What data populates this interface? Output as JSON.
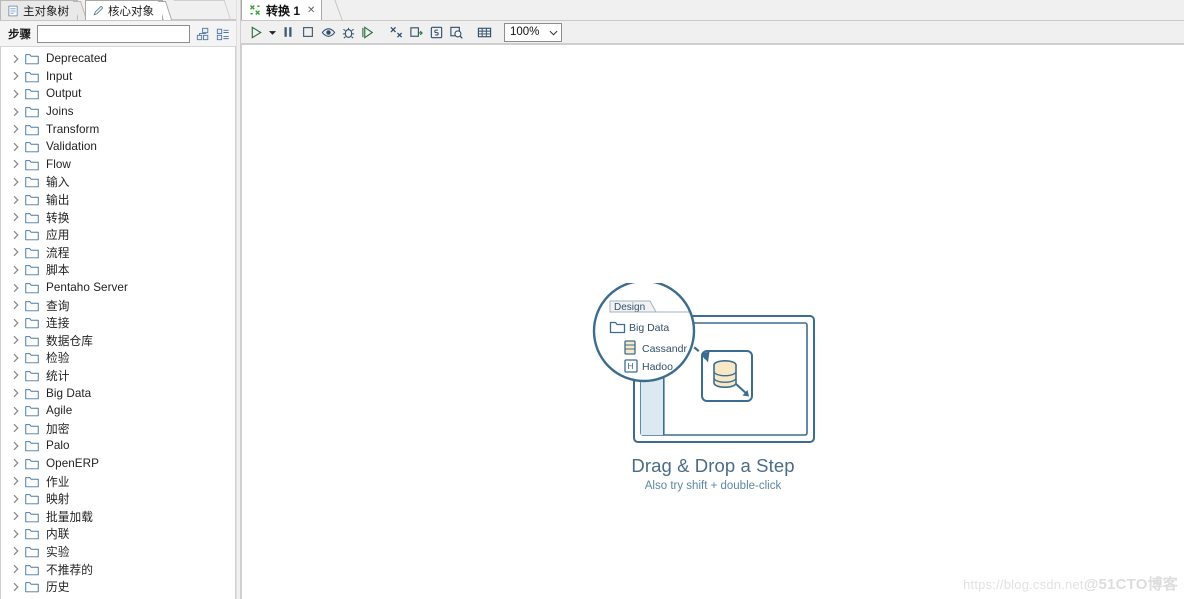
{
  "left_panel": {
    "tabs": [
      {
        "label": "主对象树",
        "icon": "document-icon",
        "active": false
      },
      {
        "label": "核心对象",
        "icon": "pencil-icon",
        "active": true
      }
    ],
    "search": {
      "label": "步骤",
      "value": "",
      "placeholder": "",
      "buttons": [
        {
          "name": "tree-view-toggle",
          "icon": "hierarchy-icon"
        },
        {
          "name": "list-view-toggle",
          "icon": "list-icon"
        }
      ]
    },
    "tree_items": [
      "Deprecated",
      "Input",
      "Output",
      "Joins",
      "Transform",
      "Validation",
      "Flow",
      "输入",
      "输出",
      "转换",
      "应用",
      "流程",
      "脚本",
      "Pentaho Server",
      "查询",
      "连接",
      "数据仓库",
      "检验",
      "统计",
      "Big Data",
      "Agile",
      "加密",
      "Palo",
      "OpenERP",
      "作业",
      "映射",
      "批量加载",
      "内联",
      "实验",
      "不推荐的",
      "历史"
    ]
  },
  "editor": {
    "tab": {
      "label": "转换 1",
      "icon": "transform-icon",
      "close": "✕"
    },
    "toolbar": {
      "buttons": [
        {
          "name": "run-button",
          "icon": "play-icon"
        },
        {
          "name": "run-options-dropdown",
          "icon": "caret-down-icon"
        },
        {
          "name": "pause-button",
          "icon": "pause-icon"
        },
        {
          "name": "stop-button",
          "icon": "stop-icon"
        },
        {
          "name": "preview-button",
          "icon": "eye-icon"
        },
        {
          "name": "debug-button",
          "icon": "bug-icon"
        },
        {
          "name": "replay-button",
          "icon": "play-outline-icon"
        },
        {
          "name": "verify-button",
          "icon": "transform-check-icon"
        },
        {
          "name": "impact-analysis-button",
          "icon": "database-impact-icon"
        },
        {
          "name": "sql-button",
          "icon": "sql-icon"
        },
        {
          "name": "inspect-button",
          "icon": "search-doc-icon"
        },
        {
          "name": "grid-button",
          "icon": "grid-icon"
        }
      ],
      "zoom": {
        "value": "100%",
        "caret": "⌄"
      }
    },
    "canvas": {
      "hero_title": "Drag & Drop a Step",
      "hero_subtitle": "Also try shift + double-click",
      "magnifier": {
        "panel_tab": "Design",
        "items": [
          {
            "label": "Big Data",
            "icon": "folder-icon"
          },
          {
            "label": "Cassandr",
            "icon": "cassandra-icon"
          },
          {
            "label": "Hadoo",
            "icon": "hadoop-icon"
          }
        ]
      }
    },
    "watermark": {
      "url": "https://blog.csdn.net",
      "handle": "@51CTO博客"
    }
  },
  "colors": {
    "accent": "#3d6d8e",
    "hero_text": "#4a6c86",
    "tree_text": "#222222",
    "folder": "#4a7ba6",
    "tab_active_bg": "#ffffff",
    "panel_bg": "#f0f0f0"
  }
}
